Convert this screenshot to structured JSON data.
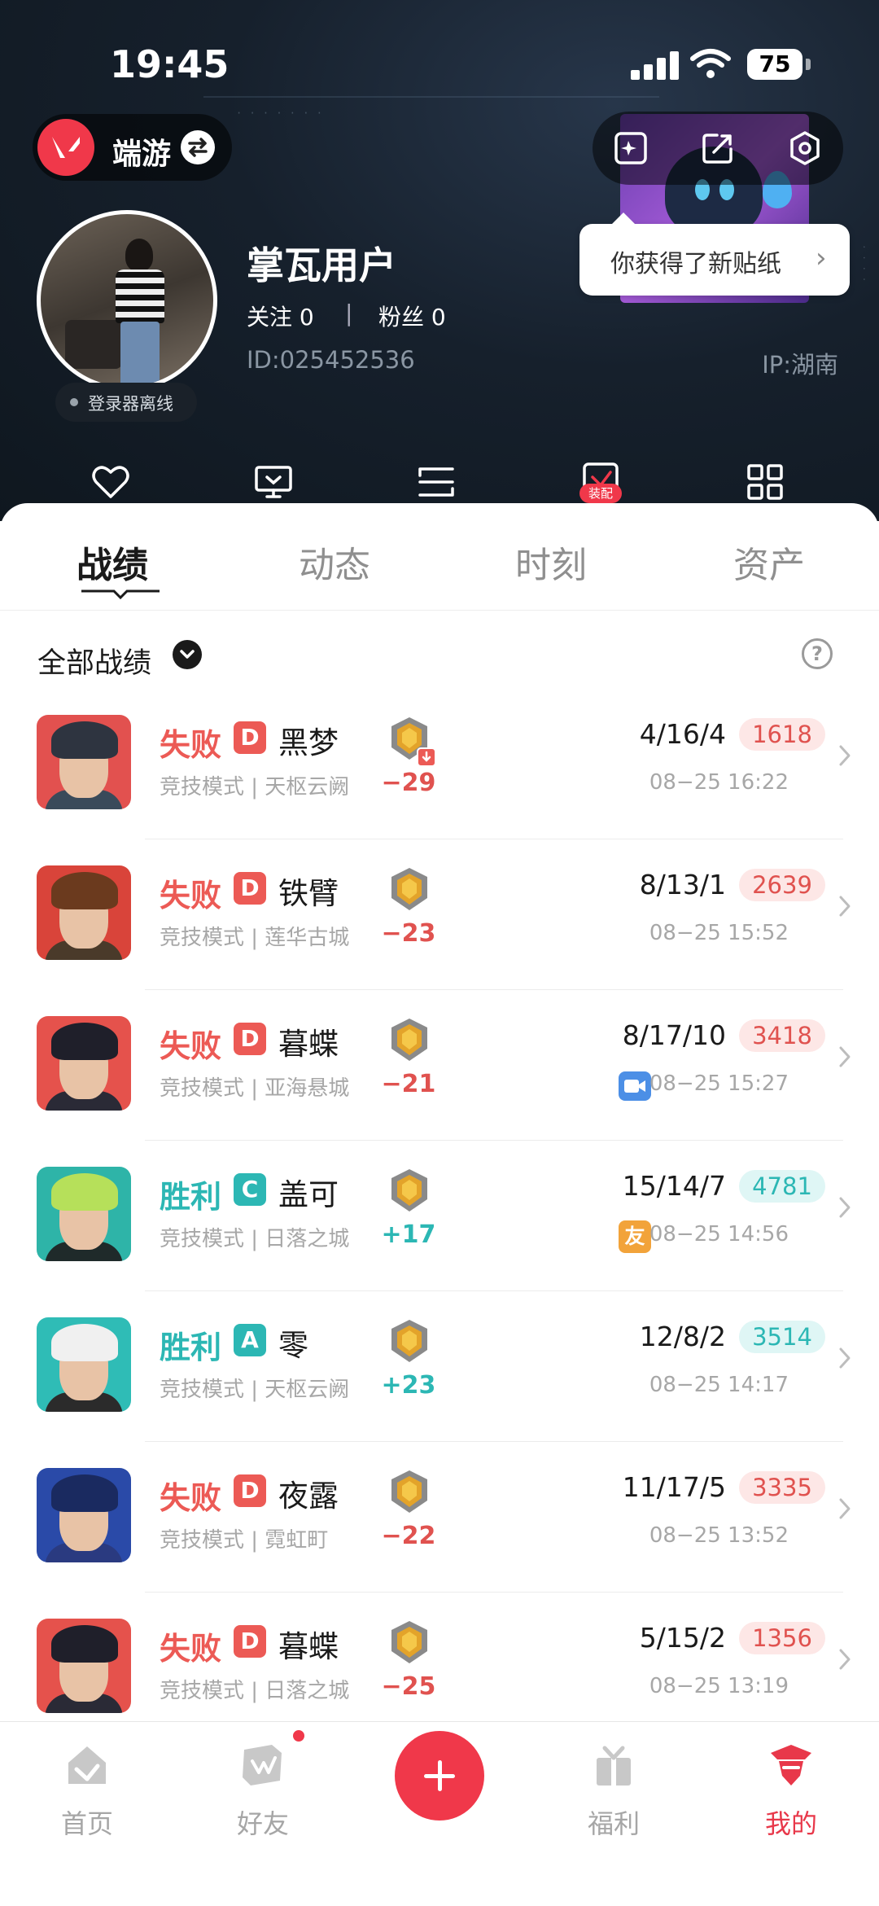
{
  "status_bar": {
    "time": "19:45",
    "battery": "75"
  },
  "header": {
    "game_name": "端游",
    "sticker_tip": "你获得了新贴纸",
    "username": "掌瓦用户",
    "follow": "关注 0",
    "separator": "|",
    "fans": "粉丝 0",
    "user_id": "ID:025452536",
    "ip": "IP:湖南",
    "online_status": "登录器离线",
    "quick_badge": "装配"
  },
  "tabs": [
    "战绩",
    "动态",
    "时刻",
    "资产"
  ],
  "filter": {
    "label": "全部战绩",
    "help": "?"
  },
  "matches": [
    {
      "result": "失败",
      "grade": "D",
      "agent": "黑梦",
      "mode": "竞技模式 | 天枢云阙",
      "rr": "−29",
      "kda": "4/16/4",
      "score": "1618",
      "datetime": "08−25 16:22",
      "outcome": "loss",
      "tag": "",
      "rank_down": true,
      "colors": {
        "bg": "#e2514f",
        "hair": "#2e3440",
        "body": "#3a4a5a"
      }
    },
    {
      "result": "失败",
      "grade": "D",
      "agent": "铁臂",
      "mode": "竞技模式 | 莲华古城",
      "rr": "−23",
      "kda": "8/13/1",
      "score": "2639",
      "datetime": "08−25 15:52",
      "outcome": "loss",
      "tag": "",
      "rank_down": false,
      "colors": {
        "bg": "#d9443a",
        "hair": "#6b3a1e",
        "body": "#4a3a2a"
      }
    },
    {
      "result": "失败",
      "grade": "D",
      "agent": "暮蝶",
      "mode": "竞技模式 | 亚海悬城",
      "rr": "−21",
      "kda": "8/17/10",
      "score": "3418",
      "datetime": "08−25 15:27",
      "outcome": "loss",
      "tag": "video",
      "rank_down": false,
      "colors": {
        "bg": "#e5524c",
        "hair": "#1f1f2a",
        "body": "#2a2a36"
      }
    },
    {
      "result": "胜利",
      "grade": "C",
      "agent": "盖可",
      "mode": "竞技模式 | 日落之城",
      "rr": "+17",
      "kda": "15/14/7",
      "score": "4781",
      "datetime": "08−25 14:56",
      "outcome": "win",
      "tag": "friend",
      "tag_text": "友",
      "rank_down": false,
      "colors": {
        "bg": "#2eb4a8",
        "hair": "#b6e05a",
        "body": "#1f2a2a"
      }
    },
    {
      "result": "胜利",
      "grade": "A",
      "agent": "零",
      "mode": "竞技模式 | 天枢云阙",
      "rr": "+23",
      "kda": "12/8/2",
      "score": "3514",
      "datetime": "08−25 14:17",
      "outcome": "win",
      "tag": "",
      "rank_down": false,
      "colors": {
        "bg": "#2fbcb6",
        "hair": "#f0f0f0",
        "body": "#2b2b2b"
      }
    },
    {
      "result": "失败",
      "grade": "D",
      "agent": "夜露",
      "mode": "竞技模式 | 霓虹町",
      "rr": "−22",
      "kda": "11/17/5",
      "score": "3335",
      "datetime": "08−25 13:52",
      "outcome": "loss",
      "tag": "",
      "rank_down": false,
      "colors": {
        "bg": "#2a4aa8",
        "hair": "#1a2a60",
        "body": "#2a3a80"
      }
    },
    {
      "result": "失败",
      "grade": "D",
      "agent": "暮蝶",
      "mode": "竞技模式 | 日落之城",
      "rr": "−25",
      "kda": "5/15/2",
      "score": "1356",
      "datetime": "08−25 13:19",
      "outcome": "loss",
      "tag": "",
      "rank_down": false,
      "colors": {
        "bg": "#e5524c",
        "hair": "#1f1f2a",
        "body": "#2a2a36"
      }
    }
  ],
  "bottom_nav": [
    {
      "label": "首页",
      "icon": "home-icon",
      "active": false
    },
    {
      "label": "好友",
      "icon": "friends-icon",
      "active": false
    },
    {
      "label": "福利",
      "icon": "gift-icon",
      "active": false
    },
    {
      "label": "我的",
      "icon": "profile-icon",
      "active": true
    }
  ],
  "colors": {
    "accent": "#f0384a",
    "loss": "#ec5a55",
    "win": "#2cb7b4"
  }
}
